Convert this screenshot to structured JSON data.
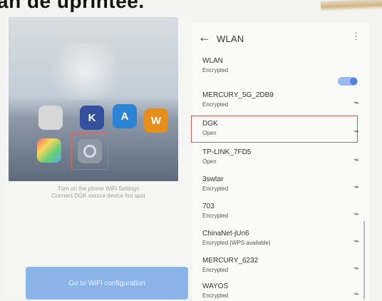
{
  "caption": {
    "text": "an de uprintee."
  },
  "left_panel": {
    "instructions_line1": "Turn on the phone WiFi Settings",
    "instructions_line2": "Connect DGK xxxxxx device hot spot",
    "button_label": "Go to WiFi configuration",
    "app_icons": [
      {
        "name": "camera-icon",
        "label": ""
      },
      {
        "name": "k-app-icon",
        "label": "K"
      },
      {
        "name": "appstore-icon",
        "label": "A"
      },
      {
        "name": "orange-app-icon",
        "label": "W"
      },
      {
        "name": "photos-icon",
        "label": ""
      },
      {
        "name": "settings-icon",
        "label": ""
      }
    ]
  },
  "right_panel": {
    "title": "WLAN",
    "back_icon": "←",
    "more_icon": "⋮",
    "top_row_title": "WLAN",
    "top_row_subtitle": "Encrypted",
    "toggle_state": "on",
    "networks": [
      {
        "name": "MERCURY_5G_2DB9",
        "status": "Encrypted",
        "signal": "wifi-locked"
      },
      {
        "name": "DGK",
        "status": "Open",
        "signal": "wifi-open",
        "highlighted": true
      },
      {
        "name": "TP-LINK_7FD5",
        "status": "Open",
        "signal": "wifi-open"
      },
      {
        "name": "3swtar",
        "status": "Encrypted",
        "signal": "wifi-locked"
      },
      {
        "name": "703",
        "status": "Encrypted",
        "signal": "wifi-locked"
      },
      {
        "name": "ChinaNet-jUn6",
        "status": "Encrypted (WPS available)",
        "signal": "wifi-locked"
      },
      {
        "name": "MERCURY_6232",
        "status": "Encrypted",
        "signal": "wifi-locked"
      },
      {
        "name": "WAYOS",
        "status": "Encrypted",
        "signal": "wifi-locked"
      }
    ]
  },
  "colors": {
    "highlight_border": "#c45f52",
    "toggle_on": "#4f83dc",
    "button_bg": "#8ab4e7"
  }
}
